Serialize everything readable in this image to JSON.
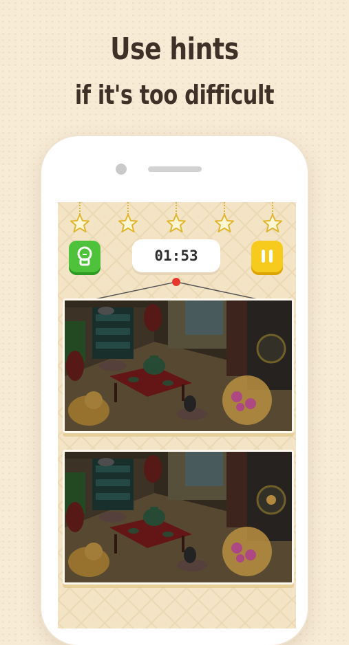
{
  "headline": {
    "line1": "Use hints",
    "line2": "if it's too difficult"
  },
  "game": {
    "stars_total": 5,
    "stars_filled": 0,
    "timer": "01:53",
    "buttons": {
      "hint_icon": "lightbulb-icon",
      "pause_icon": "pause-icon"
    }
  },
  "colors": {
    "background": "#f7ebd6",
    "hint_button": "#4ec23a",
    "pause_button": "#f7cb1d",
    "star_outline": "#e0b530",
    "rope_marker": "#e8362c"
  }
}
